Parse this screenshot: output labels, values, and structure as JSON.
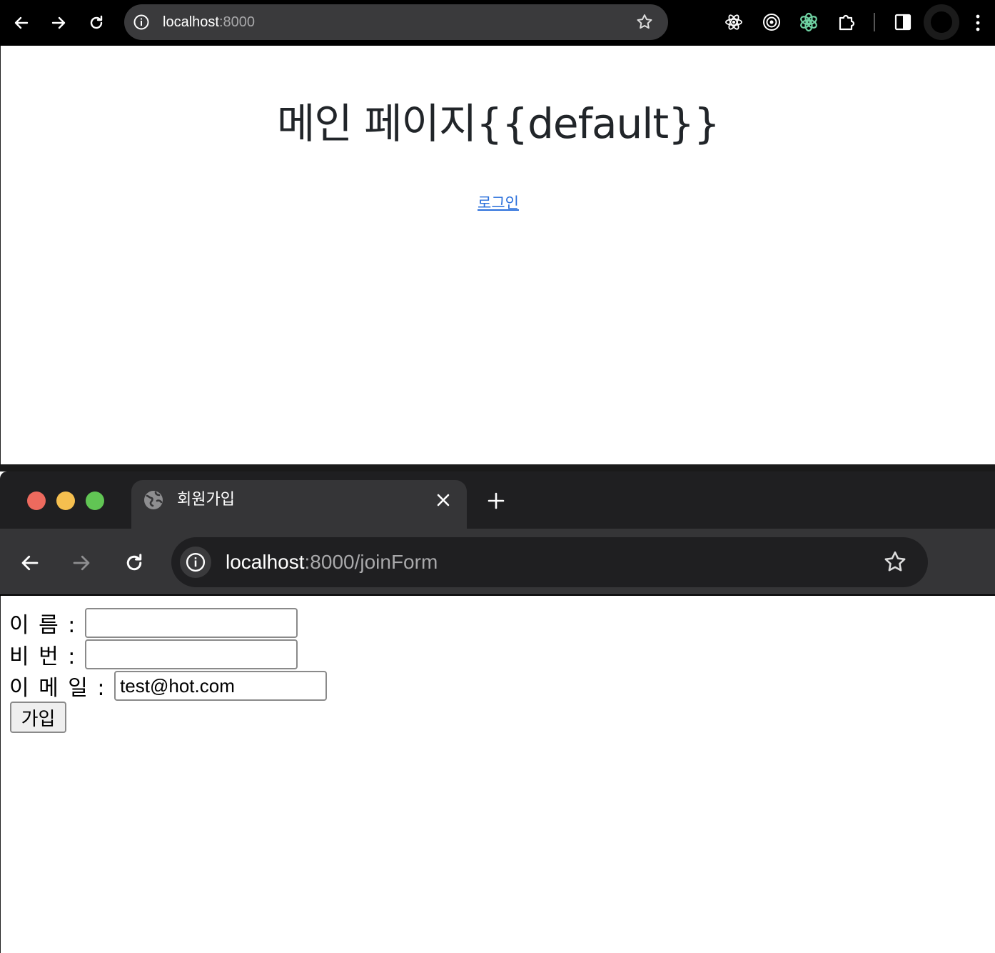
{
  "top_window": {
    "url_host": "localhost",
    "url_rest": ":8000",
    "heading": "메인 페이지{{default}}",
    "link": "로그인"
  },
  "bottom_window": {
    "tab_title": "회원가입",
    "url_host": "localhost",
    "url_rest": ":8000/joinForm",
    "form": {
      "name_label": "이 름 : ",
      "password_label": "비 번 : ",
      "email_label": "이 메 일 : ",
      "name_value": "",
      "password_value": "",
      "email_value": "test@hot.com",
      "submit_label": "가입"
    }
  },
  "colors": {
    "link": "#2a6fdb",
    "close_dot": "#ed6a5e",
    "minimize_dot": "#f5bf4f",
    "zoom_dot": "#61c554",
    "chatgpt_icon": "#6fd1a2"
  },
  "icons": [
    "back-icon",
    "forward-icon",
    "reload-icon",
    "info-icon",
    "star-icon",
    "react-devtools-icon",
    "target-icon",
    "chatgpt-icon",
    "puzzle-icon",
    "side-panel-icon",
    "profile-avatar",
    "menu-icon",
    "globe-icon",
    "close-icon",
    "plus-icon"
  ]
}
